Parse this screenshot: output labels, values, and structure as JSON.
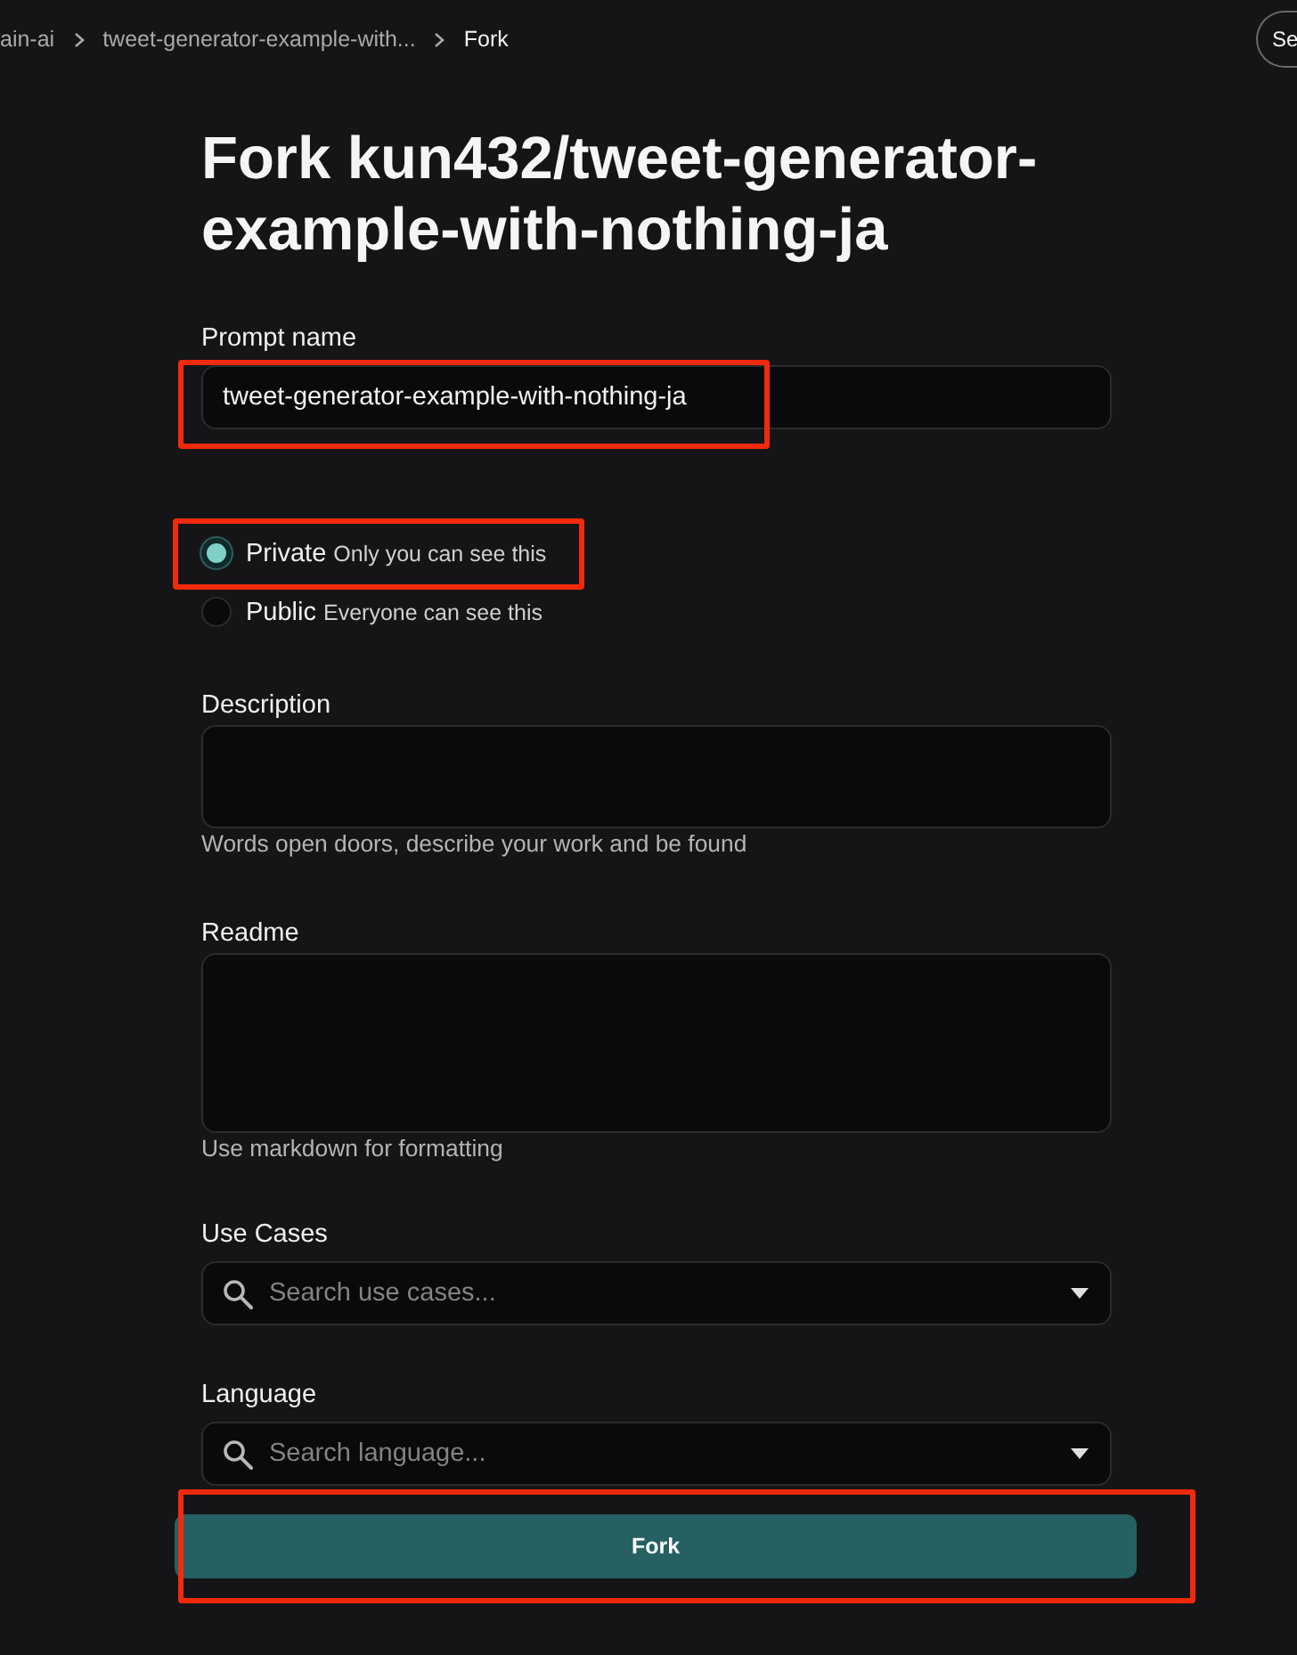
{
  "breadcrumb": [
    {
      "label": "ain-ai",
      "current": false
    },
    {
      "label": "tweet-generator-example-with...",
      "current": false
    },
    {
      "label": "Fork",
      "current": true
    }
  ],
  "header_button": {
    "label": "Se"
  },
  "title": "Fork kun432/tweet-generator-example-with-nothing-ja",
  "prompt_name": {
    "label": "Prompt name",
    "value": "tweet-generator-example-with-nothing-ja",
    "highlighted": true
  },
  "visibility": [
    {
      "label": "Private",
      "hint": "Only you can see this",
      "selected": true,
      "highlighted": true
    },
    {
      "label": "Public",
      "hint": "Everyone can see this",
      "selected": false,
      "highlighted": false
    }
  ],
  "description": {
    "label": "Description",
    "helper": "Words open doors, describe your work and be found"
  },
  "readme": {
    "label": "Readme",
    "helper": "Use markdown for formatting"
  },
  "use_cases": {
    "label": "Use Cases",
    "placeholder": "Search use cases..."
  },
  "language": {
    "label": "Language",
    "placeholder": "Search language..."
  },
  "fork_button": {
    "label": "Fork",
    "highlighted": true
  }
}
